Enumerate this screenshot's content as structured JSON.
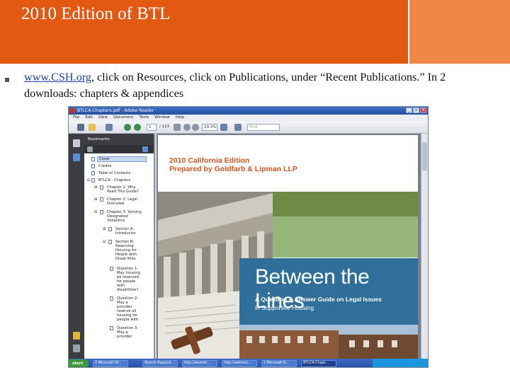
{
  "slide": {
    "title": "2010 Edition of BTL",
    "link_text": "www.CSH.org",
    "body_rest_line1": ", click on Resources, click on Publications, under “Recent Publications.” In 2",
    "body_line2": "downloads: chapters & appendices",
    "colors": {
      "header": "#e25a12",
      "header_side": "#ee8748",
      "link": "#1a3fb8"
    }
  },
  "screenshot": {
    "window_title": "BTLCA-Chapters.pdf - Adobe Reader",
    "menu": [
      "File",
      "Edit",
      "View",
      "Document",
      "Tools",
      "Window",
      "Help"
    ],
    "toolbar": {
      "page_current": "1",
      "page_total": "/ 123",
      "zoom": "29.3%",
      "find_placeholder": "Find"
    },
    "bookmarks_header": "Bookmarks",
    "bookmarks": [
      "Cover",
      "Credits",
      "Table of Contents",
      "BTLCA - Chapters",
      "Chapter 1: Why",
      "Read This Guide?",
      "Chapter 2: Legal",
      "Overview",
      "Chapter 3: Serving",
      "Designated",
      "Violations",
      "Section A:",
      "Introductor",
      "Section B:",
      "Reserving",
      "Housing for",
      "People with",
      "Disab lities",
      "Question 1:",
      "May housing",
      "be reserved",
      "for people",
      "with",
      "disabilities?",
      "Question 2:",
      "May a",
      "provider",
      "reserve all",
      "housing for",
      "people with",
      "Question 3:",
      "May a",
      "provider"
    ],
    "cover": {
      "edition": "2010 California Edition",
      "subtitle": "Prepared by Goldfarb & Lipman LLP",
      "title": "Between the Lines",
      "sub1": "A Question & Answer Guide on Legal Issues",
      "sub2": "in Supportive Housing"
    },
    "taskbar": {
      "start": "start",
      "tasks": [
        "2 Microsoft Of...",
        "Sharon Rapport...",
        "http://weznet...",
        "http://webmai...",
        "2 Microsoft O...",
        "BTLCA-Chapt..."
      ],
      "active_task_index": 5
    }
  }
}
